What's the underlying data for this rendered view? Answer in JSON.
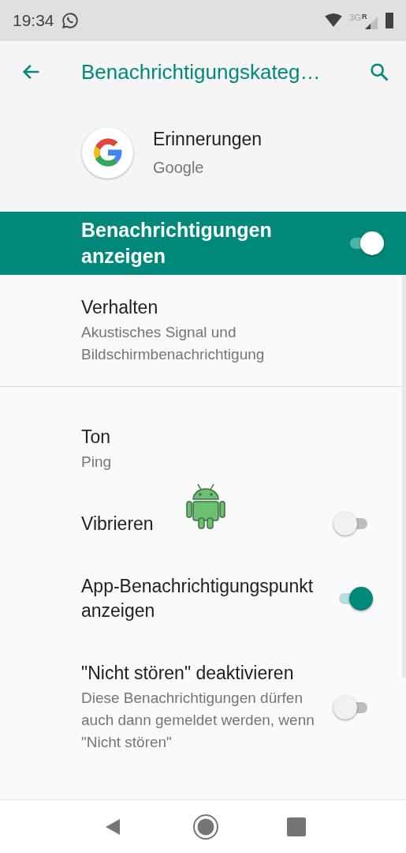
{
  "status_bar": {
    "time": "19:34",
    "network": "3G",
    "roaming": "R"
  },
  "toolbar": {
    "title": "Benachrichtigungskateg…"
  },
  "app": {
    "name": "Erinnerungen",
    "publisher": "Google"
  },
  "master": {
    "label": "Benachrichtigungen anzeigen",
    "on": true
  },
  "groups": [
    [
      {
        "kind": "plain",
        "title": "Verhalten",
        "summary": "Akustisches Signal und Bildschirmbenachrichtigung"
      }
    ],
    [
      {
        "kind": "plain",
        "title": "Ton",
        "summary": "Ping"
      },
      {
        "kind": "toggle",
        "title": "Vibrieren",
        "on": false
      },
      {
        "kind": "toggle",
        "title": "App-Benachrichtigungspunkt anzeigen",
        "on": true
      },
      {
        "kind": "toggle",
        "title": "\"Nicht stören\" deaktivieren",
        "summary": "Diese Benachrichtigungen dürfen auch dann gemeldet werden, wenn \"Nicht stören\"",
        "on": false
      }
    ]
  ]
}
